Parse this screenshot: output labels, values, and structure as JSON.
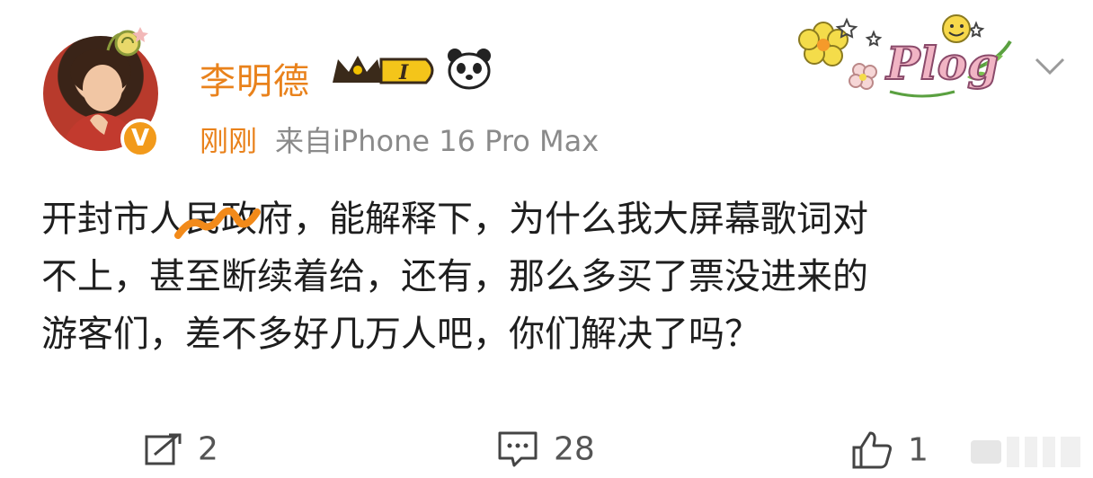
{
  "post": {
    "username": "李明德",
    "badge_level": "I",
    "time": "刚刚",
    "source": "来自iPhone 16 Pro Max",
    "sticker_text": "Plog",
    "content_lines": [
      "开封市人民政府，能解释下，为什么我大屏幕歌词对",
      "不上，甚至断续着给，还有，那么多买了票没进来的",
      "游客们，差不多好几万人吧，你们解决了吗？"
    ]
  },
  "actions": {
    "repost_count": "2",
    "comment_count": "28",
    "like_count": "1"
  },
  "colors": {
    "accent": "#e9821c",
    "meta_gray": "#8a8a8a",
    "text": "#1e1e1e"
  },
  "icons": [
    "verified-v-icon",
    "crown-icon",
    "level-badge-icon",
    "panda-icon",
    "plog-sticker-icon",
    "chevron-down-icon",
    "repost-icon",
    "comment-icon",
    "like-icon"
  ]
}
